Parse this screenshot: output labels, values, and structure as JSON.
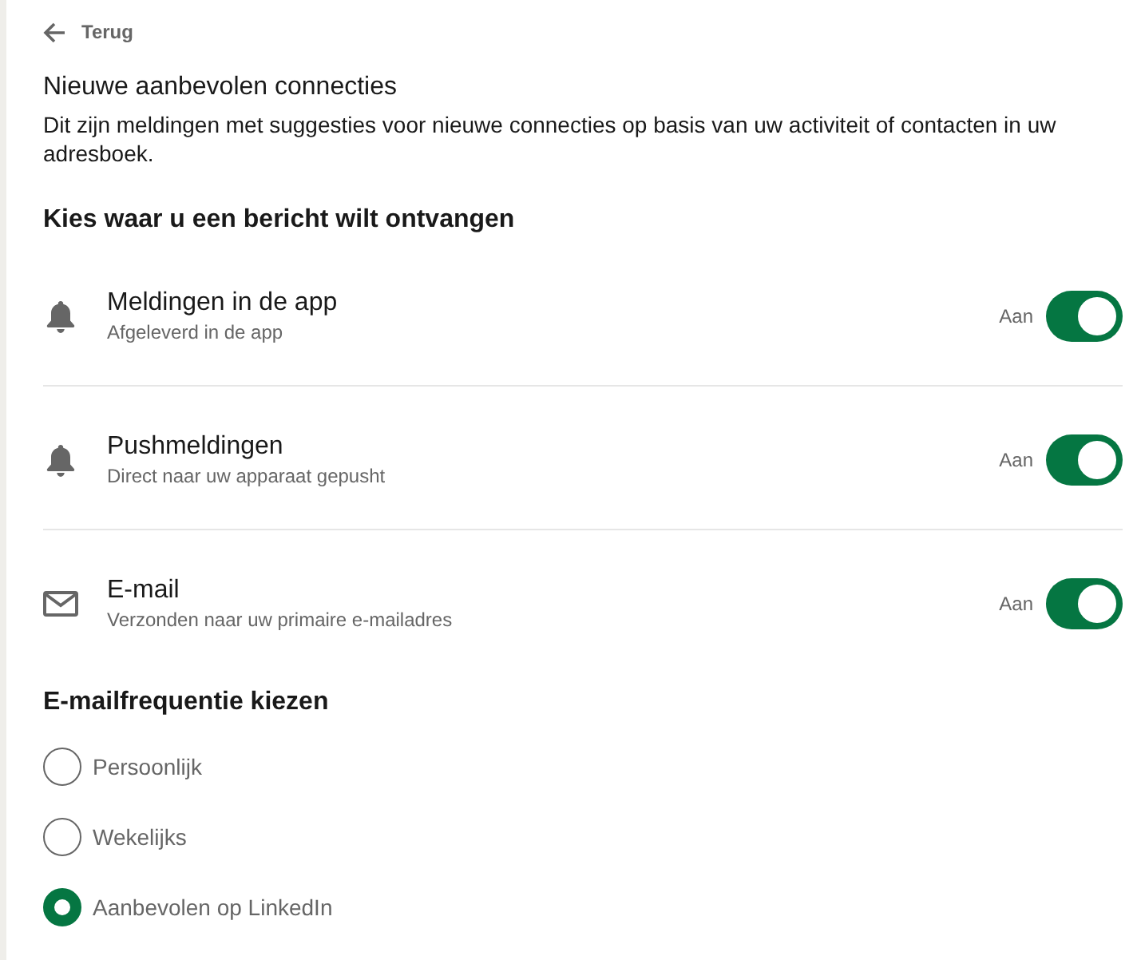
{
  "back_link": {
    "label": "Terug"
  },
  "section": {
    "title": "Nieuwe aanbevolen connecties",
    "description": "Dit zijn meldingen met suggesties voor nieuwe connecties op basis van uw activiteit of contacten in uw adresboek."
  },
  "channels_heading": "Kies waar u een bericht wilt ontvangen",
  "channels": [
    {
      "kind": "bell",
      "title": "Meldingen in de app",
      "subtitle": "Afgeleverd in de app",
      "status": "Aan",
      "on": true
    },
    {
      "kind": "bell",
      "title": "Pushmeldingen",
      "subtitle": "Direct naar uw apparaat gepusht",
      "status": "Aan",
      "on": true
    },
    {
      "kind": "mail",
      "title": "E-mail",
      "subtitle": "Verzonden naar uw primaire e-mailadres",
      "status": "Aan",
      "on": true
    }
  ],
  "frequency": {
    "heading": "E-mailfrequentie kiezen",
    "options": [
      {
        "label": "Persoonlijk",
        "selected": false
      },
      {
        "label": "Wekelijks",
        "selected": false
      },
      {
        "label": "Aanbevolen op LinkedIn",
        "selected": true
      }
    ]
  }
}
